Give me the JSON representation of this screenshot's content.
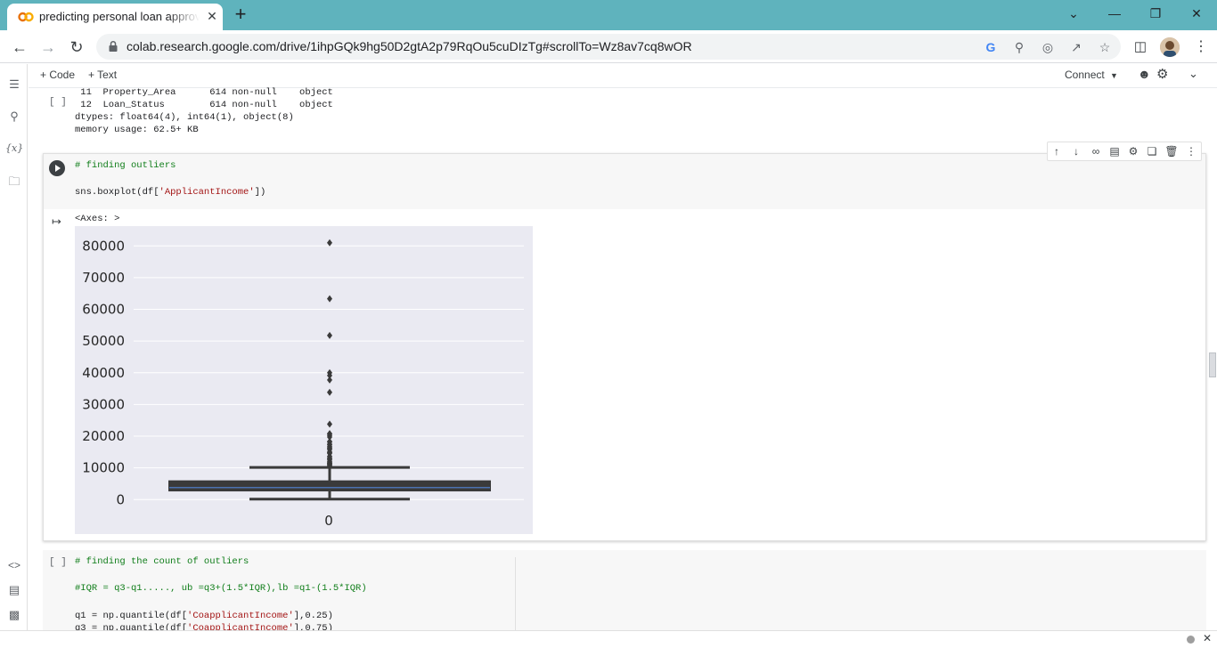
{
  "browser": {
    "tab_title": "predicting personal loan approva",
    "tab_close": "✕",
    "new_tab": "+",
    "url": "colab.research.google.com/drive/1ihpGQk9hg50D2gtA2p79RqOu5cuDIzTg#scrollTo=Wz8av7cq8wOR",
    "window_controls": {
      "dropdown": "⌄",
      "minimize": "—",
      "restore": "❐",
      "close": "✕"
    }
  },
  "colab_toolbar": {
    "code_label": "+ Code",
    "text_label": "+ Text",
    "connect_label": "Connect"
  },
  "left_sidebar": {
    "items": [
      "toc-icon",
      "search-icon",
      "variables-icon",
      "files-icon",
      "code-snippets-icon",
      "command-palette-icon",
      "terminal-icon"
    ],
    "variables_label": "{x}"
  },
  "previous_cell": {
    "bracket": "[ ]",
    "output_lines": [
      " 11  Property_Area      614 non-null    object",
      " 12  Loan_Status        614 non-null    object",
      "dtypes: float64(4), int64(1), object(8)",
      "memory usage: 62.5+ KB"
    ]
  },
  "active_cell": {
    "code_comment": "# finding outliers",
    "code_prefix": "sns.boxplot(df[",
    "code_string": "'ApplicantIncome'",
    "code_suffix": "])",
    "output_text": "<Axes: >"
  },
  "next_cell": {
    "bracket": "[ ]",
    "line1": "# finding the count of outliers",
    "line2": "#IQR = q3-q1....., ub =q3+(1.5*IQR),lb =q1-(1.5*IQR)",
    "line3_prefix": "q1 = np.quantile(df[",
    "line3_string": "'CoapplicantIncome'",
    "line3_suffix": "],0.25)",
    "line4_prefix": "q3 = np.quantile(df[",
    "line4_string": "'CoapplicantIncome'",
    "line4_suffix": "],0.75)"
  },
  "chart_data": {
    "type": "boxplot",
    "categories": [
      "0"
    ],
    "yticks": [
      0,
      10000,
      20000,
      30000,
      40000,
      50000,
      60000,
      70000,
      80000
    ],
    "ylim": [
      -3000,
      84000
    ],
    "box": {
      "whisker_low": 150,
      "q1": 2878,
      "median": 3812,
      "q3": 5795,
      "whisker_high": 10171
    },
    "outliers": [
      81000,
      63337,
      51763,
      39999,
      39147,
      37719,
      33846,
      23803,
      20833,
      20667,
      20233,
      19730,
      18333,
      18165,
      17500,
      17263,
      16692,
      16666,
      16250,
      16120,
      15759,
      15000,
      14999,
      14880,
      14866,
      14583,
      13650,
      13262,
      12876,
      12841,
      12500,
      12000,
      11757,
      11500,
      11417,
      11250,
      11146,
      10833,
      10750,
      10513,
      10408
    ],
    "colors": {
      "box": "#3a3a3a",
      "median": "#4c72b0",
      "background": "#eaeaf2",
      "grid": "#ffffff"
    }
  }
}
